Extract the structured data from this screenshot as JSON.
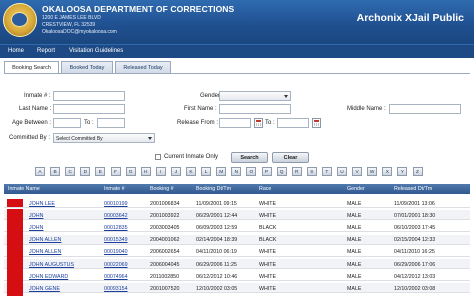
{
  "header": {
    "agency_name": "OKALOOSA DEPARTMENT OF CORRECTIONS",
    "address_line1": "1200 E JAMES LEE BLVD",
    "address_line2": "CRESTVIEW, FL 32539",
    "email": "OkaloosaDOC@myokaloosa.com",
    "app_title": "Archonix XJail Public"
  },
  "nav": {
    "items": [
      "Home",
      "Report",
      "Visitation Guidelines"
    ]
  },
  "tabs": [
    {
      "label": "Booking Search",
      "active": true
    },
    {
      "label": "Booked Today",
      "active": false
    },
    {
      "label": "Released Today",
      "active": false
    }
  ],
  "form": {
    "inmate_no_label": "Inmate # :",
    "last_name_label": "Last Name :",
    "first_name_label": "First Name :",
    "middle_name_label": "Middle Name :",
    "gender_label": "Gender :",
    "gender_value": "",
    "age_between_label": "Age Between :",
    "to_label": "To :",
    "release_from_label": "Release From :",
    "release_to_label": "To :",
    "committed_by_label": "Committed By :",
    "committed_by_value": "Select Committed By",
    "current_inmate_label": "Current Inmate Only",
    "search_button": "Search",
    "clear_button": "Clear"
  },
  "letters": [
    "A",
    "B",
    "C",
    "D",
    "E",
    "F",
    "G",
    "H",
    "I",
    "J",
    "K",
    "L",
    "M",
    "N",
    "O",
    "P",
    "Q",
    "R",
    "S",
    "T",
    "U",
    "V",
    "W",
    "X",
    "Y",
    "Z"
  ],
  "table": {
    "columns": [
      "Inmate Name",
      "Inmate #",
      "Booking #",
      "Booking Dt/Tm",
      "Race",
      "Gender",
      "Released Dt/Tm"
    ],
    "rows": [
      [
        "JOHN LEE",
        "00010199",
        "2001006834",
        "11/09/2001 09:15",
        "WHITE",
        "MALE",
        "11/09/2001 13:06"
      ],
      [
        "JOHN",
        "00003642",
        "2001003922",
        "06/29/2001 12:44",
        "WHITE",
        "MALE",
        "07/01/2001 18:30"
      ],
      [
        "JOHN",
        "00012835",
        "2003003405",
        "06/09/2003 12:59",
        "BLACK",
        "MALE",
        "06/10/2003 17:45"
      ],
      [
        "JOHN ALLEN",
        "00015349",
        "2004001062",
        "02/14/2004 18:39",
        "BLACK",
        "MALE",
        "02/15/2004 12:33"
      ],
      [
        "JOHN ALLEN",
        "00019040",
        "2006002654",
        "04/11/2010 06:19",
        "WHITE",
        "MALE",
        "04/11/2010 16:25"
      ],
      [
        "JOHN AUGUSTUS",
        "00022069",
        "2006004045",
        "06/29/2006 11:25",
        "WHITE",
        "MALE",
        "06/29/2006 17:06"
      ],
      [
        "JOHN EDWARD",
        "00074964",
        "2011002850",
        "06/12/2012 10:46",
        "WHITE",
        "MALE",
        "04/12/2012 13:03"
      ],
      [
        "JOHN GENE",
        "00093154",
        "2001007520",
        "12/10/2002 03:05",
        "WHITE",
        "MALE",
        "12/10/2002 03:08"
      ]
    ]
  }
}
